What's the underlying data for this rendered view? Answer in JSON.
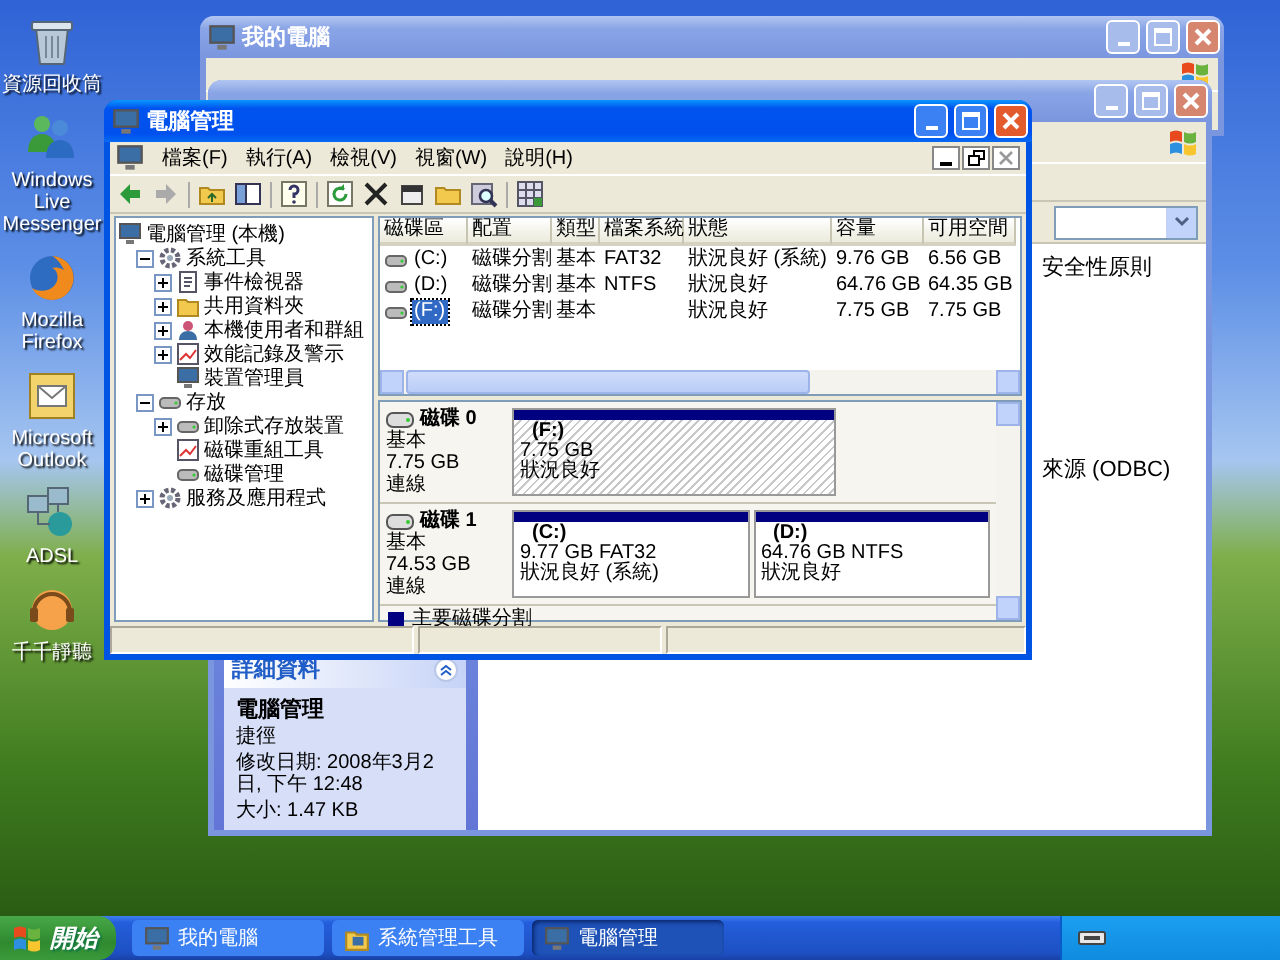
{
  "desktop_icons": [
    {
      "label": "資源回收筒",
      "kind": "recycle_bin"
    },
    {
      "label": "Windows Live Messenger",
      "kind": "messenger"
    },
    {
      "label": "Mozilla Firefox",
      "kind": "browser"
    },
    {
      "label": "Microsoft Outlook",
      "kind": "mail"
    },
    {
      "label": "ADSL",
      "kind": "network"
    },
    {
      "label": "千千靜聽",
      "kind": "music"
    }
  ],
  "my_computer_window": {
    "title": "我的電腦",
    "active": false
  },
  "admin_tools_window": {
    "active": false,
    "items": [
      "安全性原則",
      "來源 (ODBC)"
    ],
    "details": {
      "heading": "詳細資料",
      "name": "電腦管理",
      "type": "捷徑",
      "modified": "修改日期: 2008年3月2日, 下午 12:48",
      "size": "大小: 1.47 KB"
    }
  },
  "computer_management": {
    "title": "電腦管理",
    "active": true,
    "menu": [
      "檔案(F)",
      "執行(A)",
      "檢視(V)",
      "視窗(W)",
      "說明(H)"
    ],
    "tree": [
      {
        "label": "電腦管理 (本機)",
        "kind": "computer",
        "children": [
          {
            "label": "系統工具",
            "kind": "gear",
            "expanded": true,
            "children": [
              {
                "label": "事件檢視器",
                "kind": "log",
                "expanded": false
              },
              {
                "label": "共用資料夾",
                "kind": "folder",
                "expanded": false
              },
              {
                "label": "本機使用者和群組",
                "kind": "users",
                "expanded": false
              },
              {
                "label": "效能記錄及警示",
                "kind": "chart",
                "expanded": false
              },
              {
                "label": "裝置管理員",
                "kind": "computer"
              }
            ]
          },
          {
            "label": "存放",
            "kind": "disk",
            "expanded": true,
            "children": [
              {
                "label": "卸除式存放裝置",
                "kind": "disk",
                "expanded": false
              },
              {
                "label": "磁碟重組工具",
                "kind": "chart"
              },
              {
                "label": "磁碟管理",
                "kind": "disk"
              }
            ]
          },
          {
            "label": "服務及應用程式",
            "kind": "gear",
            "expanded": false
          }
        ]
      }
    ],
    "volumes": {
      "columns": [
        "磁碟區",
        "配置",
        "類型",
        "檔案系統",
        "狀態",
        "容量",
        "可用空間"
      ],
      "rows": [
        {
          "volume": "(C:)",
          "layout": "磁碟分割",
          "type": "基本",
          "file_system": "FAT32",
          "status": "狀況良好 (系統)",
          "capacity": "9.76 GB",
          "free_space": "6.56 GB",
          "selected": false
        },
        {
          "volume": "(D:)",
          "layout": "磁碟分割",
          "type": "基本",
          "file_system": "NTFS",
          "status": "狀況良好",
          "capacity": "64.76 GB",
          "free_space": "64.35 GB",
          "selected": false
        },
        {
          "volume": "(F:)",
          "layout": "磁碟分割",
          "type": "基本",
          "status": "狀況良好",
          "capacity": "7.75 GB",
          "free_space": "7.75 GB",
          "selected": true
        }
      ]
    },
    "disks": [
      {
        "name": "磁碟 0",
        "type": "基本",
        "size": "7.75 GB",
        "status": "連線",
        "partitions": [
          {
            "label": "(F:)",
            "details": "7.75 GB",
            "status": "狀況良好",
            "selected": true
          }
        ]
      },
      {
        "name": "磁碟 1",
        "type": "基本",
        "size": "74.53 GB",
        "status": "連線",
        "partitions": [
          {
            "label": "(C:)",
            "details": "9.77 GB FAT32",
            "status": "狀況良好 (系統)",
            "selected": false
          },
          {
            "label": "(D:)",
            "details": "64.76 GB NTFS",
            "status": "狀況良好",
            "selected": false
          }
        ]
      }
    ],
    "legend": "主要磁碟分割"
  },
  "taskbar": {
    "start": "開始",
    "tasks": [
      {
        "label": "我的電腦",
        "kind": "computer",
        "selected": false
      },
      {
        "label": "系統管理工具",
        "kind": "tools",
        "selected": false
      },
      {
        "label": "電腦管理",
        "kind": "computer",
        "selected": true
      }
    ]
  }
}
